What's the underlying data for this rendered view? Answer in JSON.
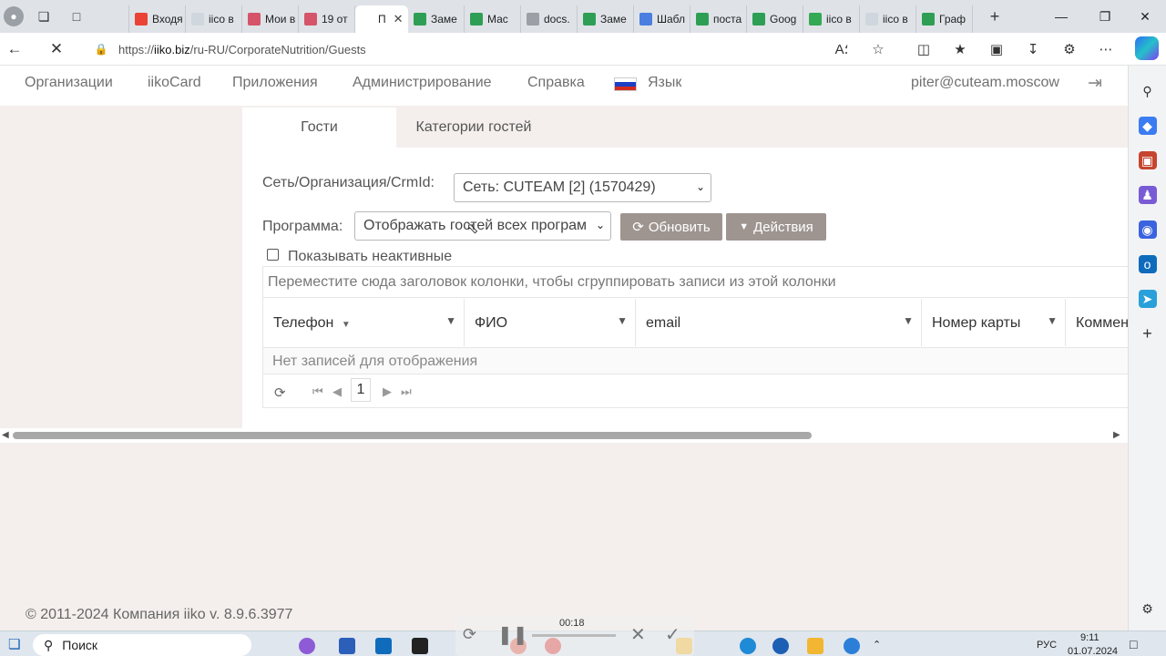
{
  "browser": {
    "tabs": [
      {
        "label": "",
        "fav": "#dfe3e8",
        "icon": "doc-icon"
      },
      {
        "label": "Входя",
        "fav": "#ea4335",
        "icon": "gmail-icon"
      },
      {
        "label": "iico в",
        "fav": "#cfd6dd",
        "icon": "drive-icon"
      },
      {
        "label": "Мои в",
        "fav": "#d6546a",
        "icon": "hh-icon"
      },
      {
        "label": "19 от",
        "fav": "#d6546a",
        "icon": "hh-icon"
      },
      {
        "label": "П",
        "fav": "#ffffff",
        "icon": "loading-icon",
        "active": true
      },
      {
        "label": "Заме",
        "fav": "#2f9e55",
        "icon": "sheets-icon"
      },
      {
        "label": "Мас",
        "fav": "#2f9e55",
        "icon": "sheets-icon"
      },
      {
        "label": "docs.",
        "fav": "#9aa0a6",
        "icon": "globe-icon"
      },
      {
        "label": "Заме",
        "fav": "#2f9e55",
        "icon": "sheets-icon"
      },
      {
        "label": "Шабл",
        "fav": "#4a7ee0",
        "icon": "docs-icon"
      },
      {
        "label": "поста",
        "fav": "#2f9e55",
        "icon": "sheets-icon"
      },
      {
        "label": "Goog",
        "fav": "#2f9e55",
        "icon": "sheets-icon"
      },
      {
        "label": "iico в",
        "fav": "#34a853",
        "icon": "drive-icon"
      },
      {
        "label": "iico в",
        "fav": "#cfd6dd",
        "icon": "drive-icon"
      },
      {
        "label": "Граф",
        "fav": "#2f9e55",
        "icon": "sheets-icon"
      }
    ],
    "url_host": "iiko.biz",
    "url_scheme": "https://",
    "url_path": "/ru-RU/CorporateNutrition/Guests"
  },
  "header": {
    "menu": [
      "Организации",
      "iikoCard",
      "Приложения",
      "Администрирование",
      "Справка",
      "Язык"
    ],
    "user": "piter@cuteam.moscow"
  },
  "tabs": {
    "guests": "Гости",
    "categories": "Категории гостей"
  },
  "filters": {
    "network_label": "Сеть/Организация/CrmId:",
    "network_value": "Сеть: CUTEAM [2] (1570429)",
    "program_label": "Программа:",
    "program_value": "Отображать гостей всех програм",
    "refresh_button": "Обновить",
    "actions_button": "Действия",
    "show_inactive": "Показывать неактивные"
  },
  "grid": {
    "grouping_hint": "Переместите сюда заголовок колонки, чтобы сгруппировать записи из этой колонки",
    "columns": [
      "Телефон",
      "ФИО",
      "email",
      "Номер карты",
      "Коммен"
    ],
    "empty": "Нет записей для отображения",
    "page": "1"
  },
  "footer": "© 2011-2024 Компания iiko v. 8.9.6.3977",
  "video": {
    "time": "00:18"
  },
  "taskbar": {
    "search_placeholder": "Поиск",
    "language": "РУС",
    "time": "9:11",
    "date": "01.07.2024"
  }
}
